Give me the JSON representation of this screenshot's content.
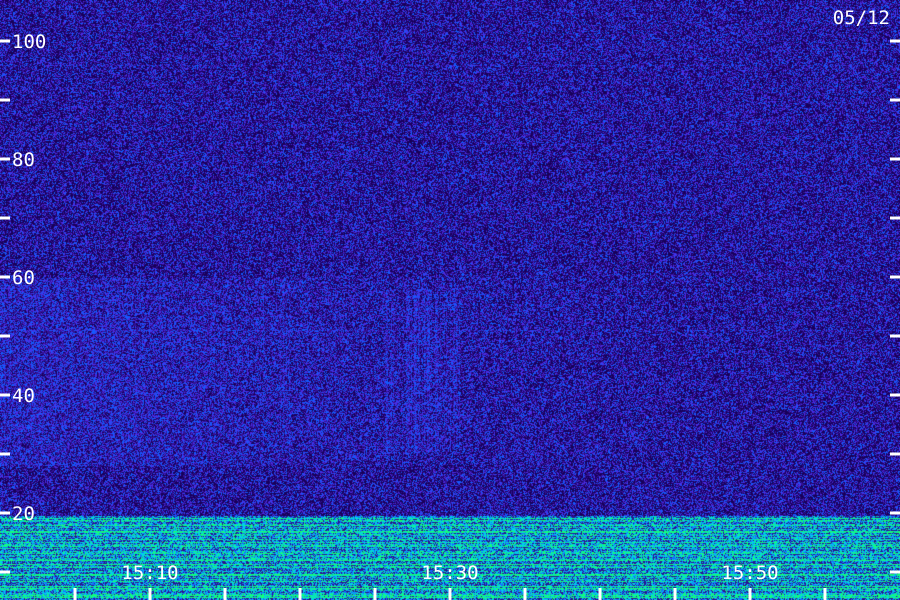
{
  "chart_data": {
    "type": "heatmap",
    "date_label": "05/12",
    "y_axis": {
      "ylim": [
        14,
        104
      ],
      "major_ticks": [
        20,
        40,
        60,
        80,
        100
      ],
      "minor_ticks": [
        30,
        50,
        70,
        90
      ],
      "tick_labels": [
        "20",
        "40",
        "60",
        "80",
        "100"
      ]
    },
    "x_axis": {
      "xlim": [
        "15:00",
        "15:58"
      ],
      "tick_labels": [
        "15:10",
        "15:30",
        "15:50"
      ],
      "tick_label_positions": [
        "15:10",
        "15:30",
        "15:50"
      ],
      "ticks": [
        "15:05",
        "15:10",
        "15:15",
        "15:20",
        "15:25",
        "15:30",
        "15:35",
        "15:40",
        "15:45",
        "15:50",
        "15:55"
      ]
    },
    "background_level": "low (dark purple noise)",
    "features": [
      {
        "kind": "strong low band",
        "y_range": [
          14,
          19
        ],
        "color": "#00ff66"
      },
      {
        "kind": "weak horizontal line",
        "y": 96
      },
      {
        "kind": "weak horizontal line",
        "y": 51
      },
      {
        "kind": "vertical streaks",
        "x_range": [
          "15:20",
          "15:30"
        ],
        "y_range": [
          30,
          59
        ]
      },
      {
        "kind": "scattered streaks",
        "x_range": [
          "15:00",
          "15:12"
        ],
        "y_range": [
          30,
          58
        ]
      }
    ],
    "colors": {
      "background": "#1a0060",
      "noise_high": "#5a2cff",
      "signal": "#1e56ff",
      "strong": "#00ffaa"
    }
  }
}
